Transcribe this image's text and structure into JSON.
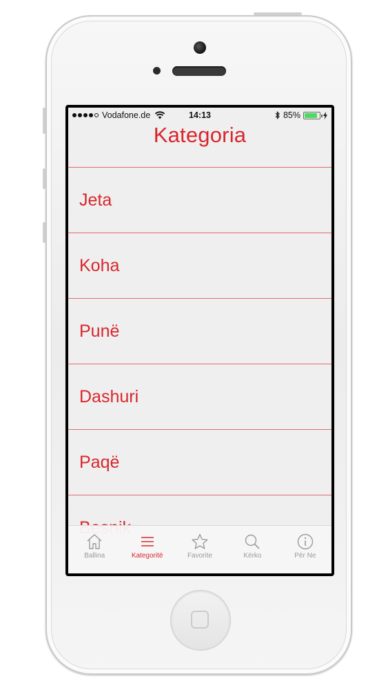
{
  "status_bar": {
    "carrier": "Vodafone.de",
    "time": "14:13",
    "battery_percent": "85%",
    "battery_level": 0.85,
    "signal_bars": 4
  },
  "nav": {
    "title": "Kategoria"
  },
  "categories": [
    "Jeta",
    "Koha",
    "Punë",
    "Dashuri",
    "Paqë",
    "Besnik"
  ],
  "tabs": [
    {
      "label": "Ballina",
      "icon": "home-icon"
    },
    {
      "label": "Kategoritë",
      "icon": "list-icon",
      "active": true
    },
    {
      "label": "Favorite",
      "icon": "star-icon"
    },
    {
      "label": "Kërko",
      "icon": "search-icon"
    },
    {
      "label": "Për Ne",
      "icon": "info-icon"
    }
  ],
  "colors": {
    "accent": "#d9262c",
    "separator": "#e36a6a",
    "inactive": "#9a9a9a",
    "background": "#efefef"
  }
}
